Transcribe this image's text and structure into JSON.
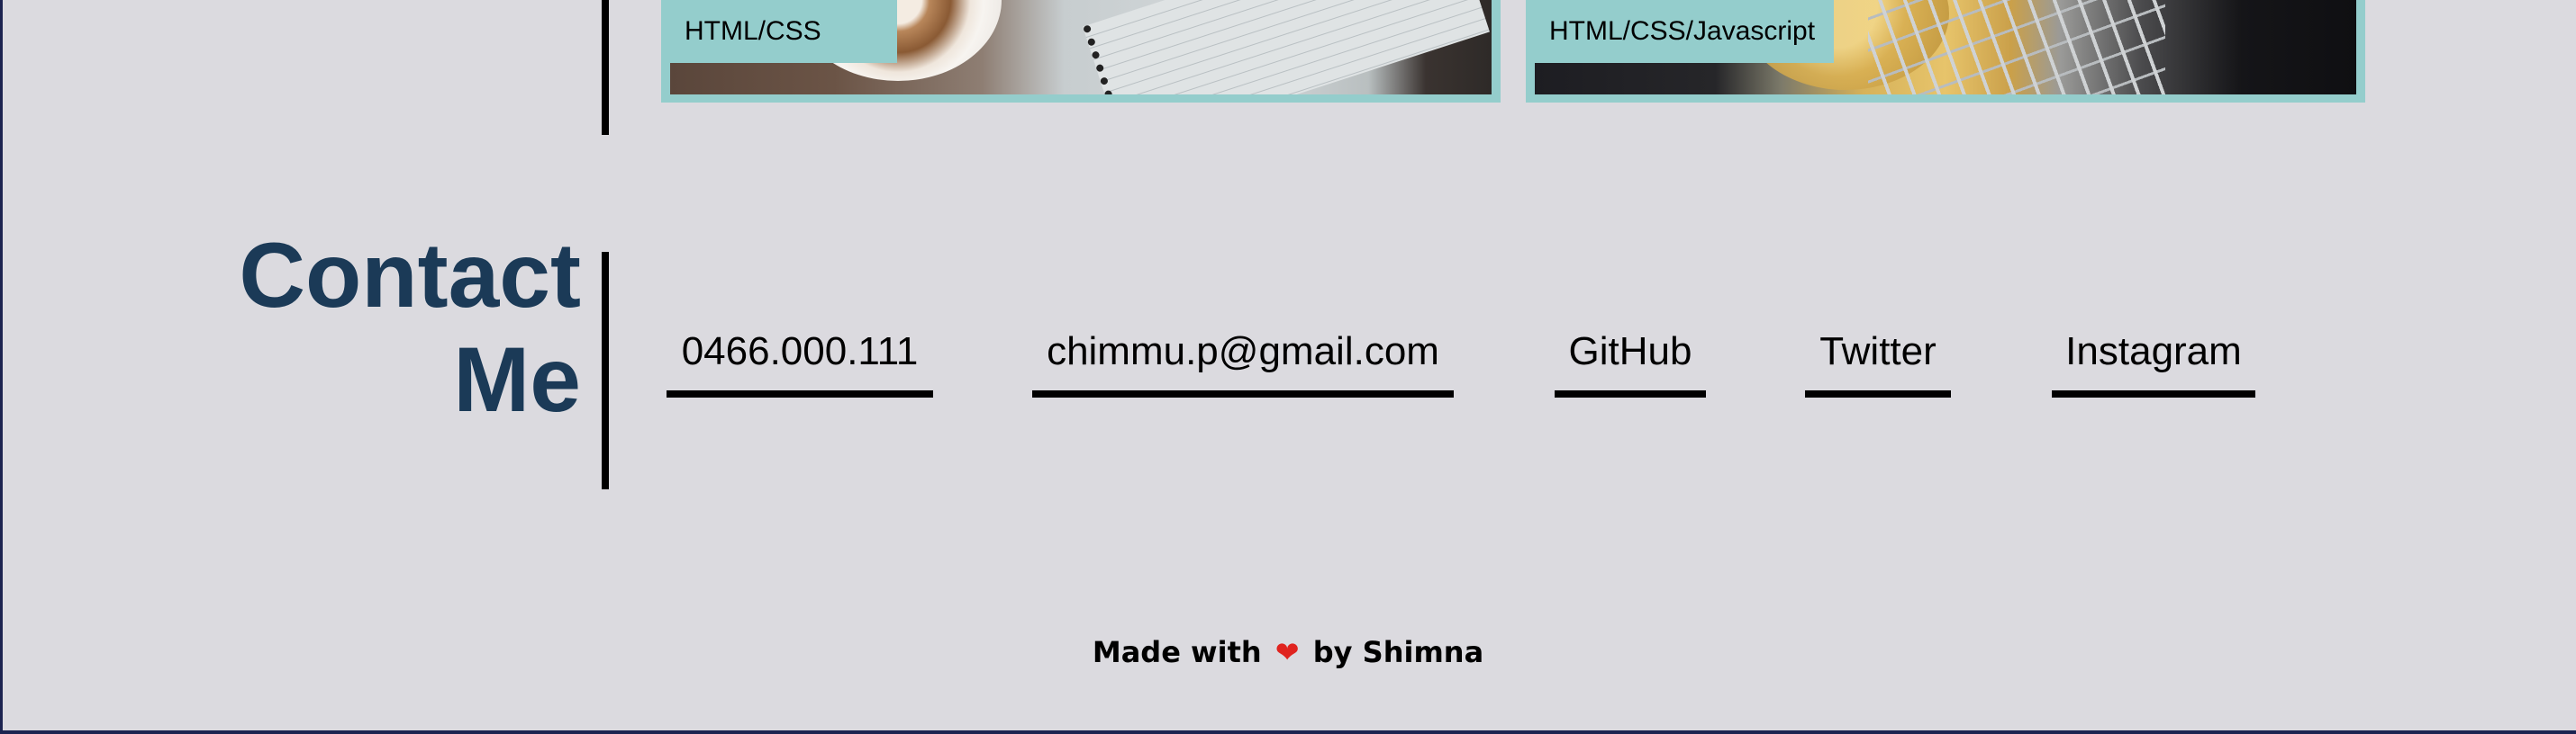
{
  "projects": [
    {
      "tag": "HTML/CSS"
    },
    {
      "tag": "HTML/CSS/Javascript"
    }
  ],
  "contact": {
    "title_line1": "Contact",
    "title_line2": "Me",
    "links": {
      "phone": "0466.000.111",
      "email": "chimmu.p@gmail.com",
      "github": "GitHub",
      "twitter": "Twitter",
      "instagram": "Instagram"
    }
  },
  "footer": {
    "prefix": "Made with",
    "heart": "❤",
    "suffix": "by Shimna"
  },
  "colors": {
    "background": "#dbdadf",
    "card_accent": "#94cdcc",
    "heading": "#1b3a57",
    "heart": "#e0231f"
  }
}
